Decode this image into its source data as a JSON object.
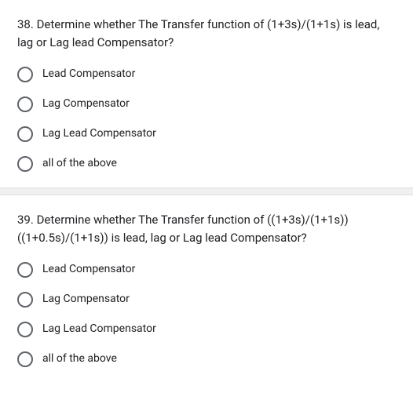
{
  "questions": [
    {
      "number": "38.",
      "text": "Determine whether The Transfer function of (1+3s)/(1+1s) is lead, lag or Lag lead Compensator?",
      "options": [
        "Lead Compensator",
        "Lag Compensator",
        "Lag Lead Compensator",
        "all of the above"
      ]
    },
    {
      "number": "39.",
      "text": "Determine whether The Transfer function of ((1+3s)/(1+1s)) ((1+0.5s)/(1+1s)) is lead, lag or Lag lead Compensator?",
      "options": [
        "Lead Compensator",
        "Lag Compensator",
        "Lag Lead Compensator",
        "all of the above"
      ]
    }
  ]
}
